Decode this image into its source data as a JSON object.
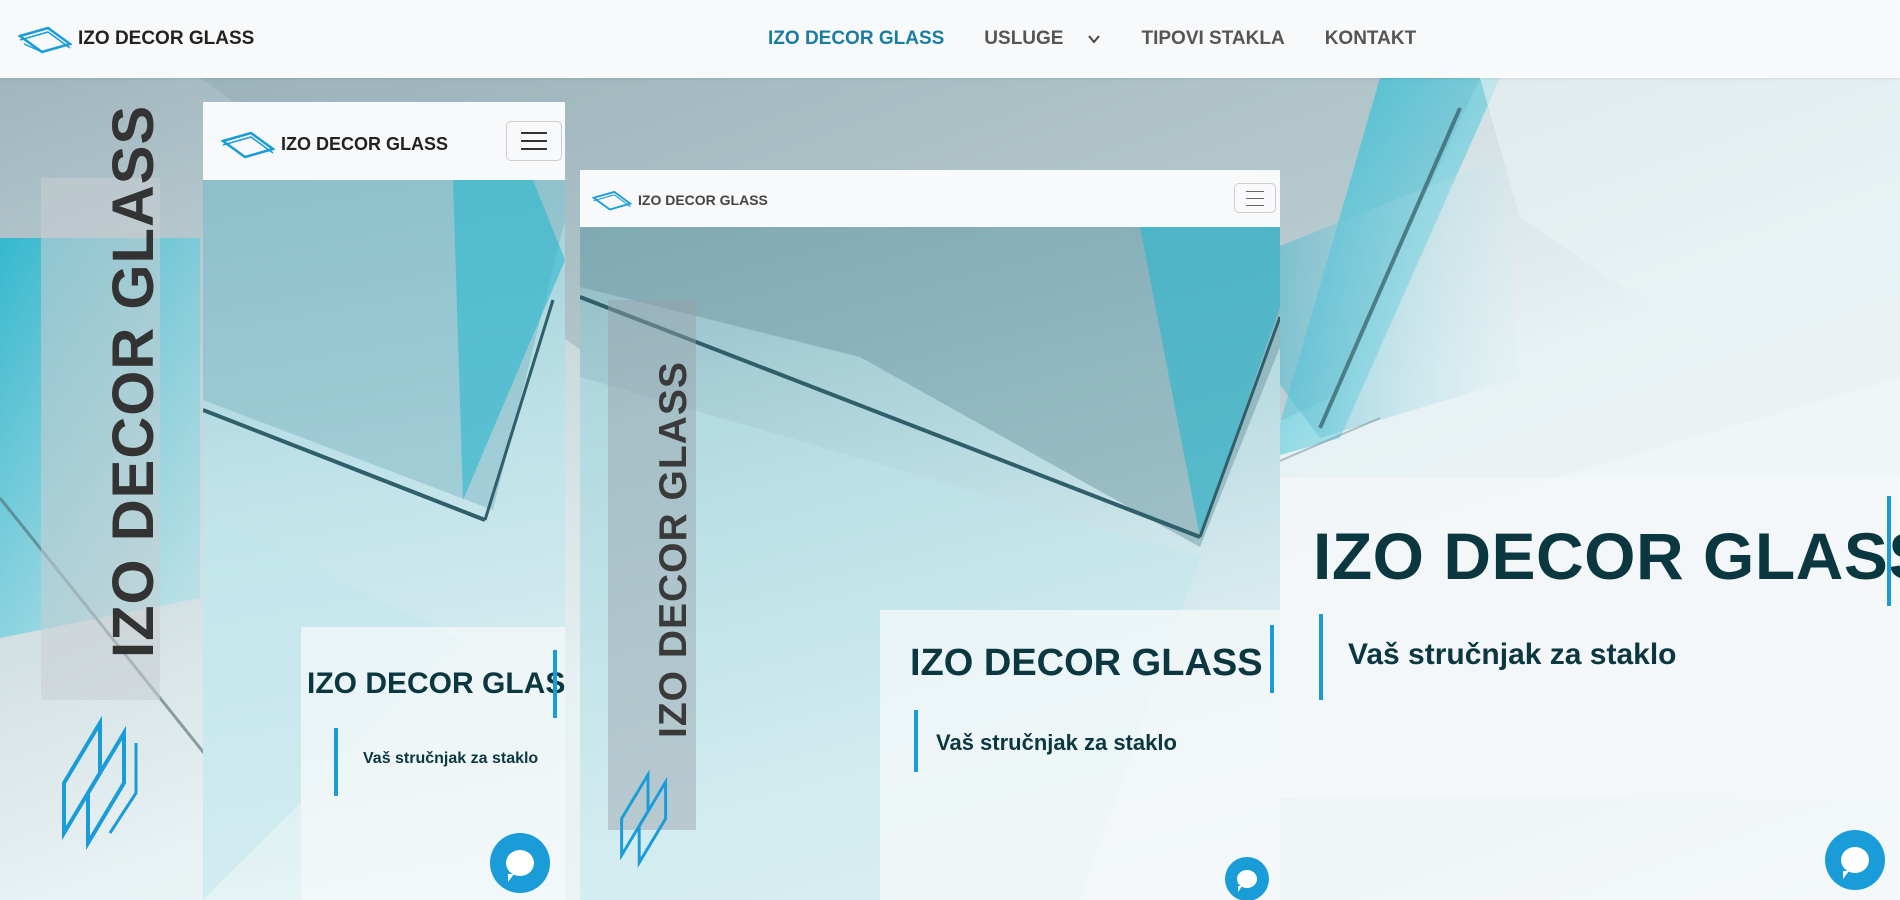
{
  "brand": {
    "name": "IZO DECOR GLASS"
  },
  "nav": {
    "items": [
      {
        "label": "IZO DECOR GLASS"
      },
      {
        "label": "USLUGE"
      },
      {
        "label": "TIPOVI STAKLA"
      },
      {
        "label": "KONTAKT"
      }
    ]
  },
  "hero": {
    "vertical_text": "IZO DECOR GLASS",
    "title": "IZO DECOR GLASS",
    "subtitle": "Vaš stručnjak za staklo"
  },
  "mobile": {
    "brand": "IZO DECOR GLASS",
    "title": "IZO DECOR GLASS",
    "subtitle": "Vaš stručnjak za staklo"
  },
  "tablet": {
    "brand": "IZO DECOR GLASS",
    "vertical_text": "IZO DECOR GLASS",
    "title": "IZO DECOR GLASS",
    "subtitle": "Vaš stručnjak za staklo"
  },
  "colors": {
    "accent": "#1a9cd8",
    "active_nav": "#1a7ca3",
    "heading": "#0b3740"
  },
  "icons": [
    "logo-icon",
    "chevron-down-icon",
    "hamburger-icon",
    "chat-icon"
  ]
}
